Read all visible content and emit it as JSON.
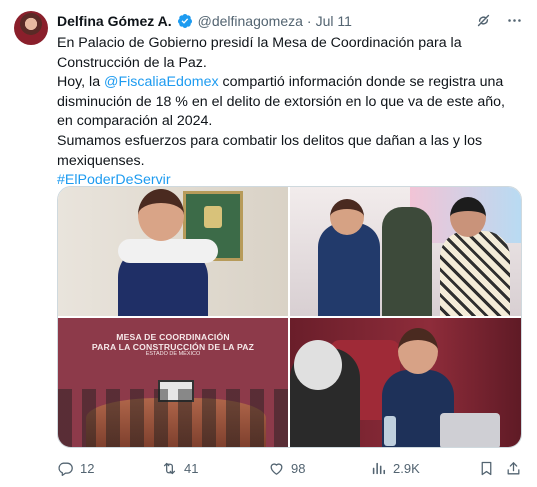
{
  "author": {
    "display_name": "Delfina Gómez A.",
    "handle": "@delfinagomeza",
    "separator": "·",
    "date": "Jul 11"
  },
  "icons": {
    "verified": "verified-badge-icon",
    "grok": "grok-icon",
    "more": "more-icon",
    "reply": "reply-icon",
    "repost": "repost-icon",
    "like": "heart-icon",
    "views": "views-icon",
    "bookmark": "bookmark-icon",
    "share": "share-icon"
  },
  "colors": {
    "link": "#1d9bf0",
    "verified": "#1d9bf0",
    "text": "#0f1419",
    "muted": "#536471"
  },
  "tweet": {
    "line1": "En Palacio de Gobierno presidí la Mesa de Coordinación para la Construcción de la Paz.",
    "line2_pre": "Hoy, la ",
    "line2_mention": "@FiscaliaEdomex",
    "line2_post": " compartió información donde se registra una disminución de 18 % en el delito de extorsión en lo que va de este año, en comparación al 2024.",
    "line3": "Sumamos esfuerzos para combatir los delitos que dañan a las y los mexiquenses.",
    "hashtag": "#ElPoderDeServir"
  },
  "media": {
    "photo3_banner_line1": "MESA DE COORDINACIÓN",
    "photo3_banner_line2": "PARA LA CONSTRUCCIÓN DE LA PAZ",
    "photo3_banner_sub": "ESTADO DE MÉXICO"
  },
  "actions": {
    "replies": "12",
    "reposts": "41",
    "likes": "98",
    "views": "2.9K"
  }
}
